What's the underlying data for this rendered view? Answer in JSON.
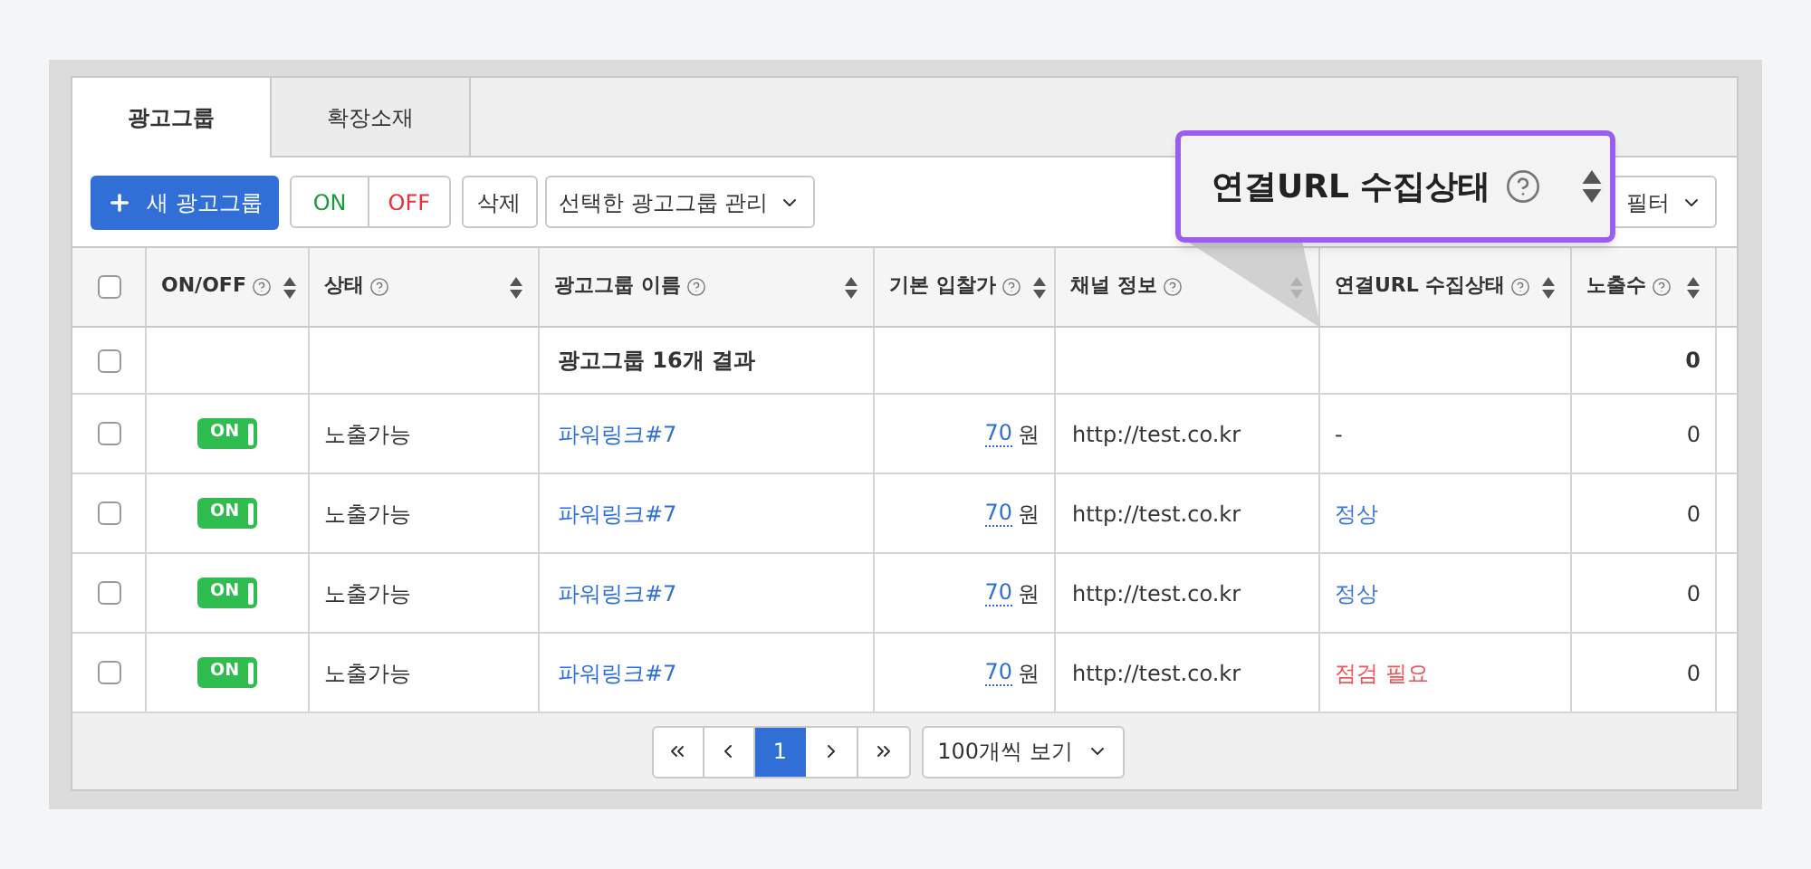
{
  "tabs": [
    {
      "label": "광고그룹",
      "selected": true
    },
    {
      "label": "확장소재",
      "selected": false
    }
  ],
  "toolbar": {
    "new_button": "새 광고그룹",
    "on_button": "ON",
    "off_button": "OFF",
    "delete_button": "삭제",
    "manage_dropdown": "선택한 광고그룹 관리",
    "filter_dropdown": "필터"
  },
  "callout": {
    "label": "연결URL 수집상태"
  },
  "table": {
    "select_all_checked": false,
    "columns": [
      {
        "label": "ON/OFF",
        "kind": "text"
      },
      {
        "label": "상태",
        "kind": "text"
      },
      {
        "label": "광고그룹 이름",
        "kind": "text"
      },
      {
        "label": "기본 입찰가",
        "kind": "number"
      },
      {
        "label": "채널 정보",
        "kind": "text"
      },
      {
        "label": "연결URL 수집상태",
        "kind": "text"
      },
      {
        "label": "노출수",
        "kind": "number"
      }
    ],
    "summary": {
      "checked": false,
      "label": "광고그룹 16개 결과",
      "impressions": "0"
    },
    "rows": [
      {
        "checked": false,
        "on": true,
        "toggle": "ON",
        "status": "노출가능",
        "name": "파워링크#7",
        "bid": "70",
        "unit": "원",
        "channel": "http://test.co.kr",
        "url_status": {
          "text": "-",
          "color": "#333333"
        },
        "impressions": "0"
      },
      {
        "checked": false,
        "on": true,
        "toggle": "ON",
        "status": "노출가능",
        "name": "파워링크#7",
        "bid": "70",
        "unit": "원",
        "channel": "http://test.co.kr",
        "url_status": {
          "text": "정상",
          "color": "#3a78d8"
        },
        "impressions": "0"
      },
      {
        "checked": false,
        "on": true,
        "toggle": "ON",
        "status": "노출가능",
        "name": "파워링크#7",
        "bid": "70",
        "unit": "원",
        "channel": "http://test.co.kr",
        "url_status": {
          "text": "정상",
          "color": "#3a78d8"
        },
        "impressions": "0"
      },
      {
        "checked": false,
        "on": true,
        "toggle": "ON",
        "status": "노출가능",
        "name": "파워링크#7",
        "bid": "70",
        "unit": "원",
        "channel": "http://test.co.kr",
        "url_status": {
          "text": "점검 필요",
          "color": "#f0545a"
        },
        "impressions": "0"
      }
    ]
  },
  "pagination": {
    "pages": [
      {
        "label": "1",
        "selected": true
      }
    ],
    "page_size": "100개씩 보기"
  }
}
